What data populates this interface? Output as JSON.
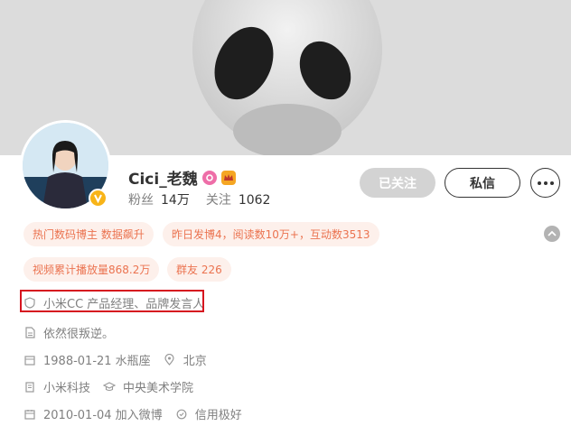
{
  "profile": {
    "name": "Cici_老魏",
    "fans_label": "粉丝",
    "fans_value": "14万",
    "following_label": "关注",
    "following_value": "1062",
    "verified_badge_color": "#f8b418"
  },
  "actions": {
    "followed_label": "已关注",
    "message_label": "私信",
    "more_icon": "more-dots-icon"
  },
  "tags": [
    "热门数码博主 数据飙升",
    "昨日发博4，阅读数10万+，互动数3513",
    "视频累计播放量868.2万",
    "群友 226"
  ],
  "info": {
    "verification": "小米CC 产品经理、品牌发言人",
    "bio": "依然很叛逆。",
    "birthday": "1988-01-21 水瓶座",
    "location": "北京",
    "company": "小米科技",
    "school": "中央美术学院",
    "join_date": "2010-01-04 加入微博",
    "credit": "信用极好"
  },
  "colors": {
    "tag_bg": "#fdf0eb",
    "tag_text": "#eb7350",
    "highlight": "#d6141f"
  }
}
